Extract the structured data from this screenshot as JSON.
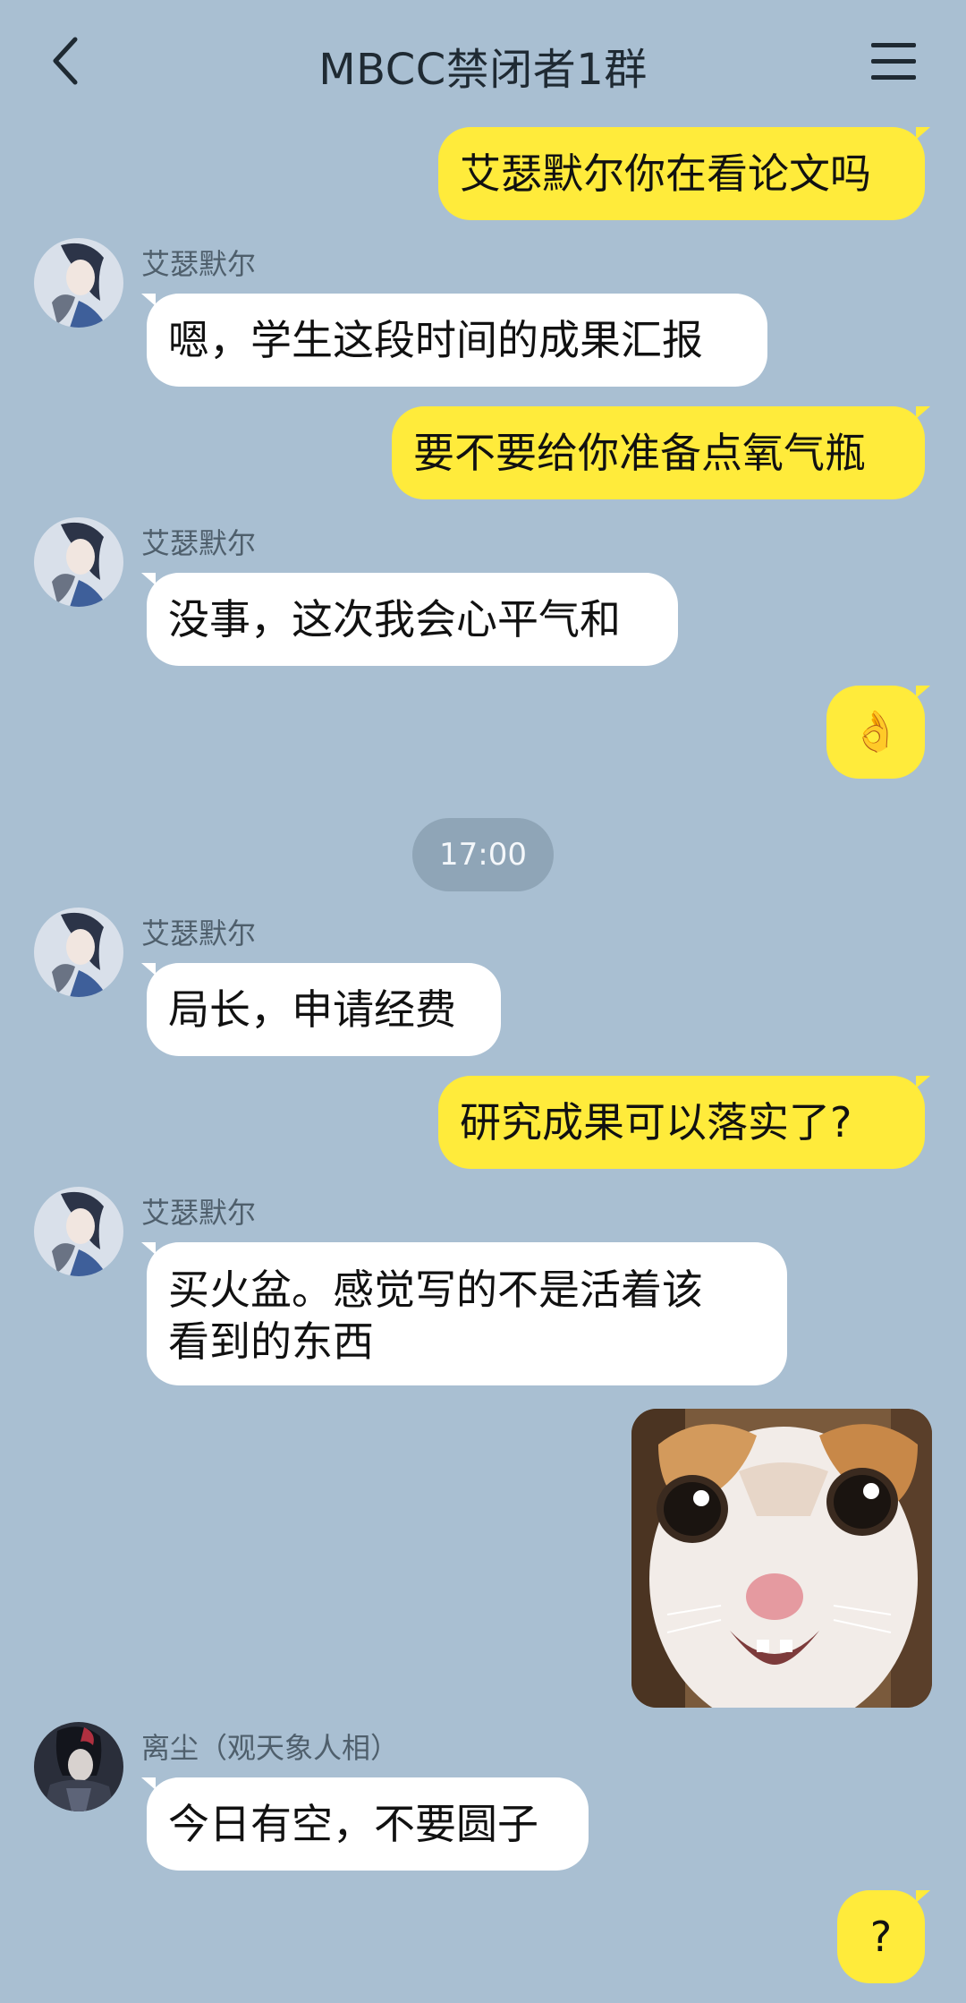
{
  "header": {
    "title": "MBCC禁闭者1群",
    "back_icon": "chevron-left-icon",
    "menu_icon": "hamburger-menu-icon"
  },
  "messages": [
    {
      "side": "me",
      "text": "艾瑟默尔你在看论文吗"
    },
    {
      "side": "other",
      "sender": "艾瑟默尔",
      "text": "嗯，学生这段时间的成果汇报"
    },
    {
      "side": "me",
      "text": "要不要给你准备点氧气瓶"
    },
    {
      "side": "other",
      "sender": "艾瑟默尔",
      "text": "没事，这次我会心平气和"
    },
    {
      "side": "me",
      "text": "👌"
    },
    {
      "side": "other",
      "sender": "艾瑟默尔",
      "text": "局长，申请经费"
    },
    {
      "side": "me",
      "text": "研究成果可以落实了?"
    },
    {
      "side": "other",
      "sender": "艾瑟默尔",
      "text_line1": "买火盆。感觉写的不是活着该",
      "text_line2": "看到的东西"
    },
    {
      "side": "me",
      "sticker": "surprised-cat-sticker"
    },
    {
      "side": "other",
      "sender": "离尘（观天象人相）",
      "text": "今日有空，不要圆子"
    },
    {
      "side": "me",
      "text": "?"
    }
  ],
  "timestamp": "17:00",
  "colors": {
    "background": "#a9bfd2",
    "my_bubble": "#ffeb3b",
    "other_bubble": "#ffffff",
    "time_pill": "#8fa5b7"
  }
}
